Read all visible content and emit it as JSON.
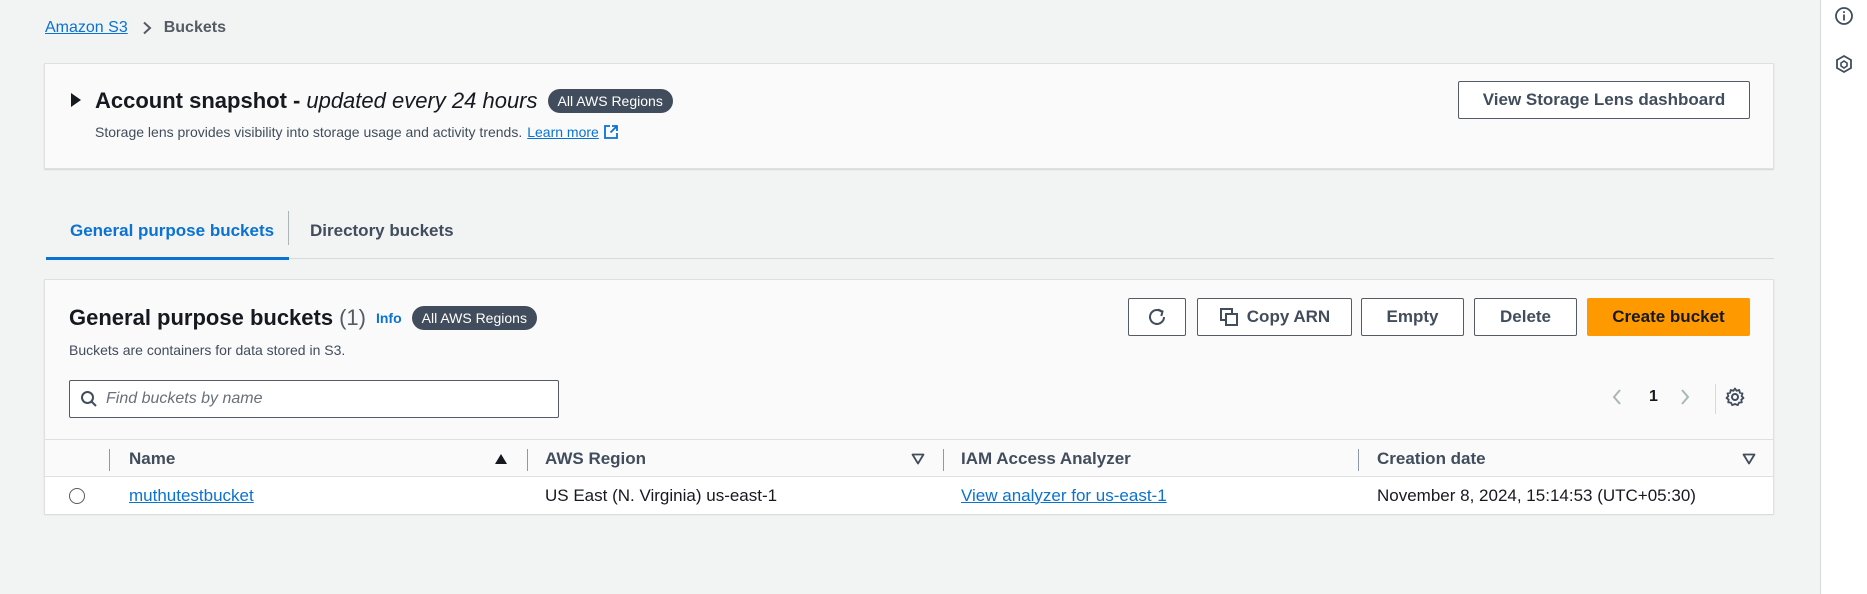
{
  "breadcrumb": {
    "root": "Amazon S3",
    "current": "Buckets"
  },
  "snapshot": {
    "title_bold": "Account snapshot -",
    "title_italic": "updated every 24 hours",
    "badge": "All AWS Regions",
    "description": "Storage lens provides visibility into storage usage and activity trends.",
    "learn_more": "Learn more",
    "dashboard_button": "View Storage Lens dashboard"
  },
  "tabs": [
    {
      "label": "General purpose buckets",
      "active": true
    },
    {
      "label": "Directory buckets",
      "active": false
    }
  ],
  "buckets": {
    "title": "General purpose buckets",
    "count": "(1)",
    "info": "Info",
    "badge": "All AWS Regions",
    "description": "Buckets are containers for data stored in S3.",
    "actions": {
      "copy_arn": "Copy ARN",
      "empty": "Empty",
      "delete": "Delete",
      "create": "Create bucket"
    },
    "search_placeholder": "Find buckets by name",
    "current_page": "1",
    "columns": [
      "Name",
      "AWS Region",
      "IAM Access Analyzer",
      "Creation date"
    ],
    "rows": [
      {
        "name": "muthutestbucket",
        "region": "US East (N. Virginia) us-east-1",
        "analyzer": "View analyzer for us-east-1",
        "created": "November 8, 2024, 15:14:53 (UTC+05:30)"
      }
    ]
  },
  "icons": {
    "info": "info-icon",
    "hex": "hexagon-icon",
    "refresh": "refresh-icon",
    "copy": "copy-icon",
    "settings": "gear-icon",
    "search": "search-icon",
    "external": "external-link-icon"
  },
  "colors": {
    "link": "#0972d3",
    "primary": "#ff9900",
    "badge": "#414d5c",
    "background": "#f2f3f3"
  }
}
